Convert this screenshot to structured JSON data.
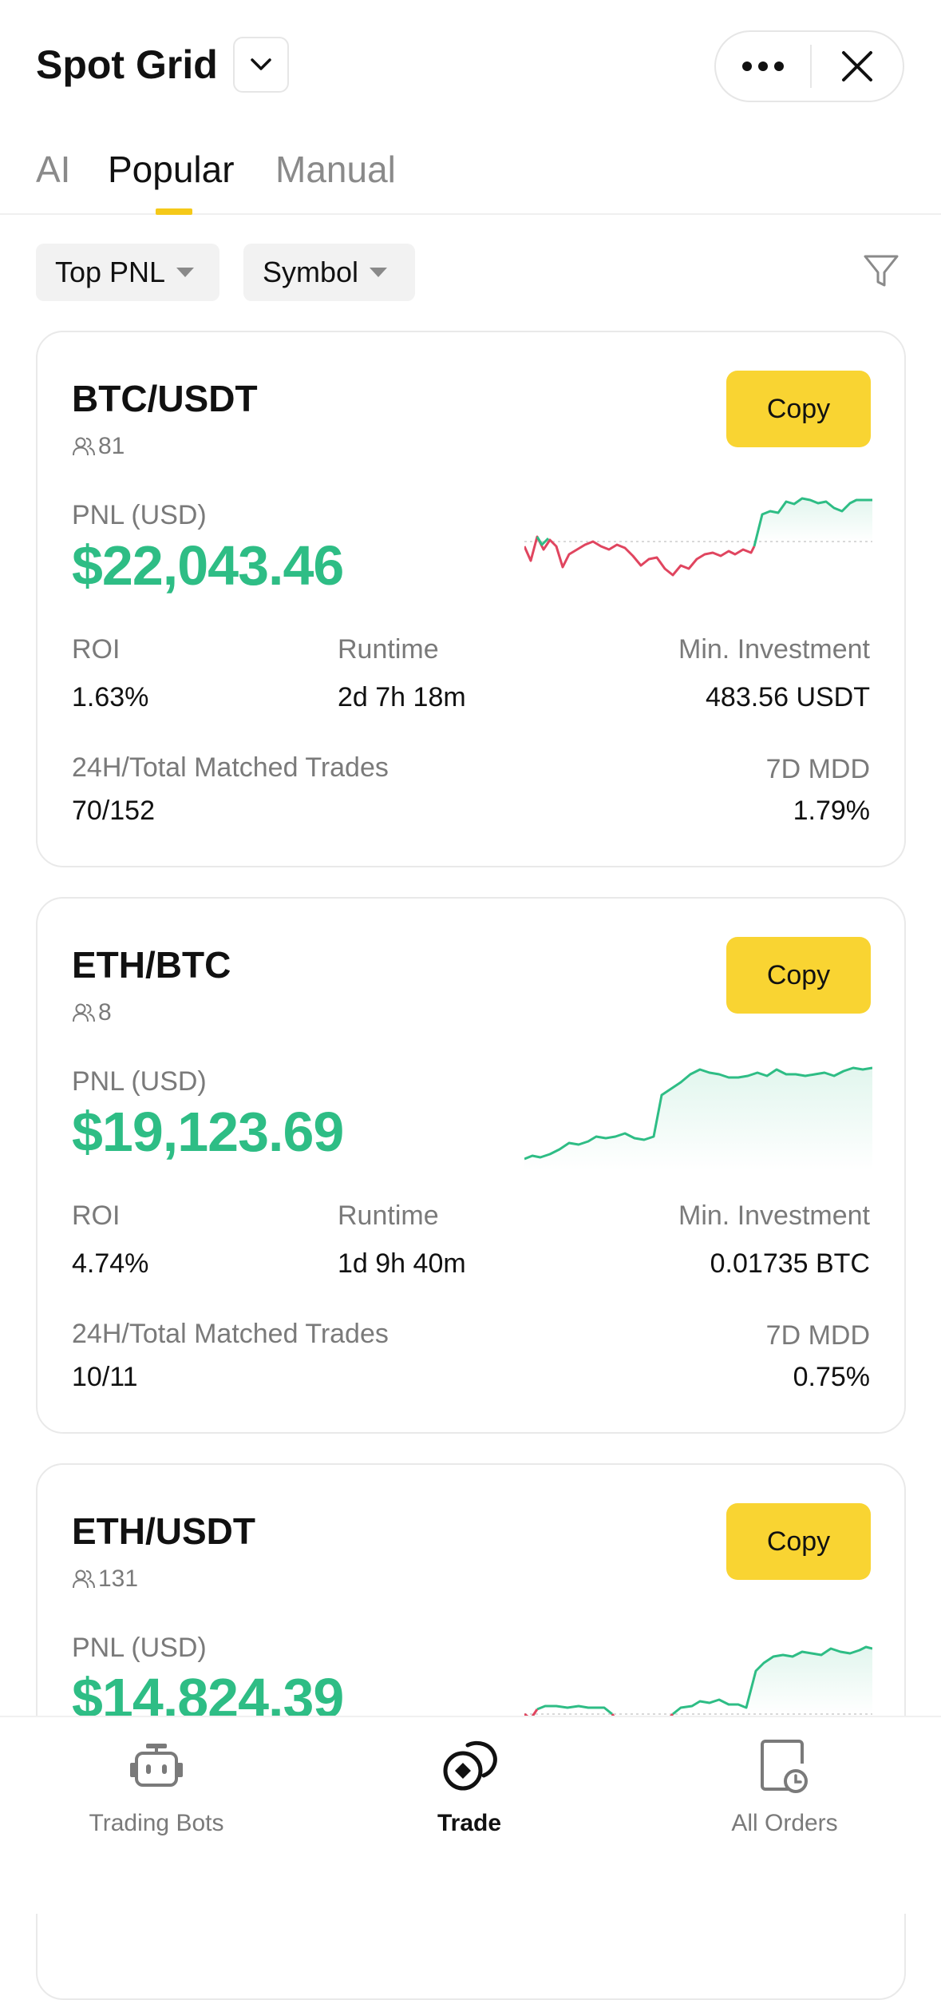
{
  "header": {
    "title": "Spot Grid"
  },
  "tabs": [
    {
      "label": "AI"
    },
    {
      "label": "Popular"
    },
    {
      "label": "Manual"
    }
  ],
  "filters": {
    "sort_label": "Top PNL",
    "symbol_label": "Symbol"
  },
  "labels": {
    "copy": "Copy",
    "pnl": "PNL (USD)",
    "roi": "ROI",
    "runtime": "Runtime",
    "min_investment": "Min. Investment",
    "matched_trades": "24H/Total Matched Trades",
    "mdd": "7D MDD"
  },
  "cards": [
    {
      "pair": "BTC/USDT",
      "followers": "81",
      "pnl": "$22,043.46",
      "roi": "1.63%",
      "runtime": "2d 7h 18m",
      "min_investment": "483.56 USDT",
      "matched_trades": "70/152",
      "mdd": "1.79%"
    },
    {
      "pair": "ETH/BTC",
      "followers": "8",
      "pnl": "$19,123.69",
      "roi": "4.74%",
      "runtime": "1d 9h 40m",
      "min_investment": "0.01735 BTC",
      "matched_trades": "10/11",
      "mdd": "0.75%"
    },
    {
      "pair": "ETH/USDT",
      "followers": "131",
      "pnl": "$14,824.39"
    }
  ],
  "nav": [
    {
      "label": "Trading Bots",
      "icon": "robot-icon"
    },
    {
      "label": "Trade",
      "icon": "trade-icon"
    },
    {
      "label": "All Orders",
      "icon": "orders-icon"
    }
  ],
  "colors": {
    "accent": "#f9d432",
    "positive": "#2ebd85",
    "negative": "#e0455f"
  }
}
